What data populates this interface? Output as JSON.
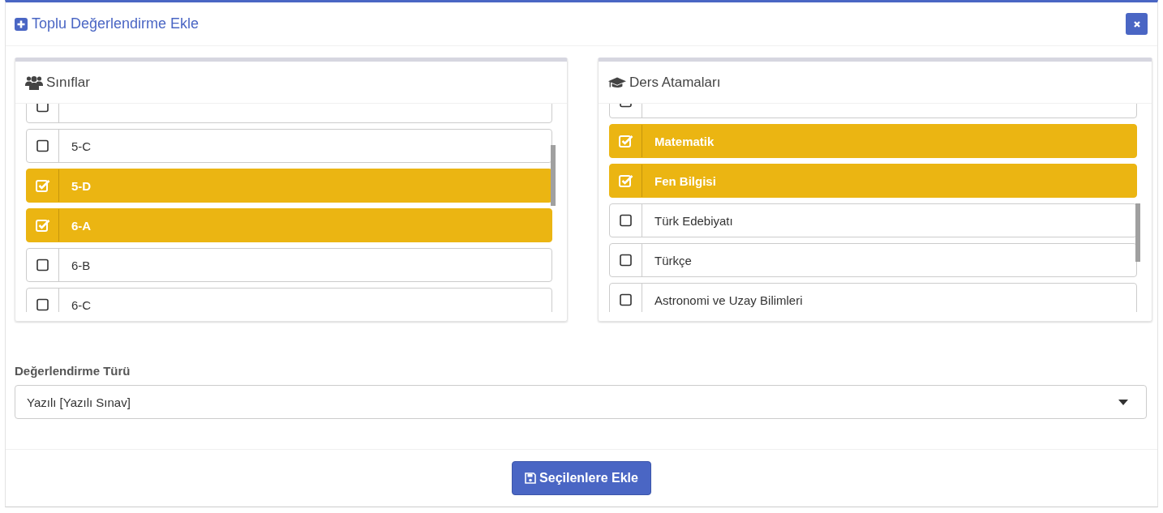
{
  "window": {
    "title": "Toplu Değerlendirme Ekle"
  },
  "panels": [
    {
      "title": "Sınıflar",
      "items": [
        {
          "checked": false
        },
        {
          "label": "5-C",
          "checked": false
        },
        {
          "label": "5-D",
          "checked": true
        },
        {
          "label": "6-A",
          "checked": true
        },
        {
          "label": "6-B",
          "checked": false
        },
        {
          "label": "6-C",
          "checked": false
        }
      ]
    },
    {
      "title": "Ders Atamaları",
      "items": [
        {
          "checked": false
        },
        {
          "label": "Matematik",
          "checked": true
        },
        {
          "label": "Fen Bilgisi",
          "checked": true
        },
        {
          "label": "Türk Edebiyatı",
          "checked": false
        },
        {
          "label": "Türkçe",
          "checked": false
        },
        {
          "label": "Astronomi ve Uzay Bilimleri",
          "checked": false
        }
      ]
    }
  ],
  "assessment_type": {
    "label": "Değerlendirme Türü",
    "value": "Yazılı [Yazılı Sınav]"
  },
  "submit_button": {
    "label": "Seçilenlere Ekle"
  }
}
